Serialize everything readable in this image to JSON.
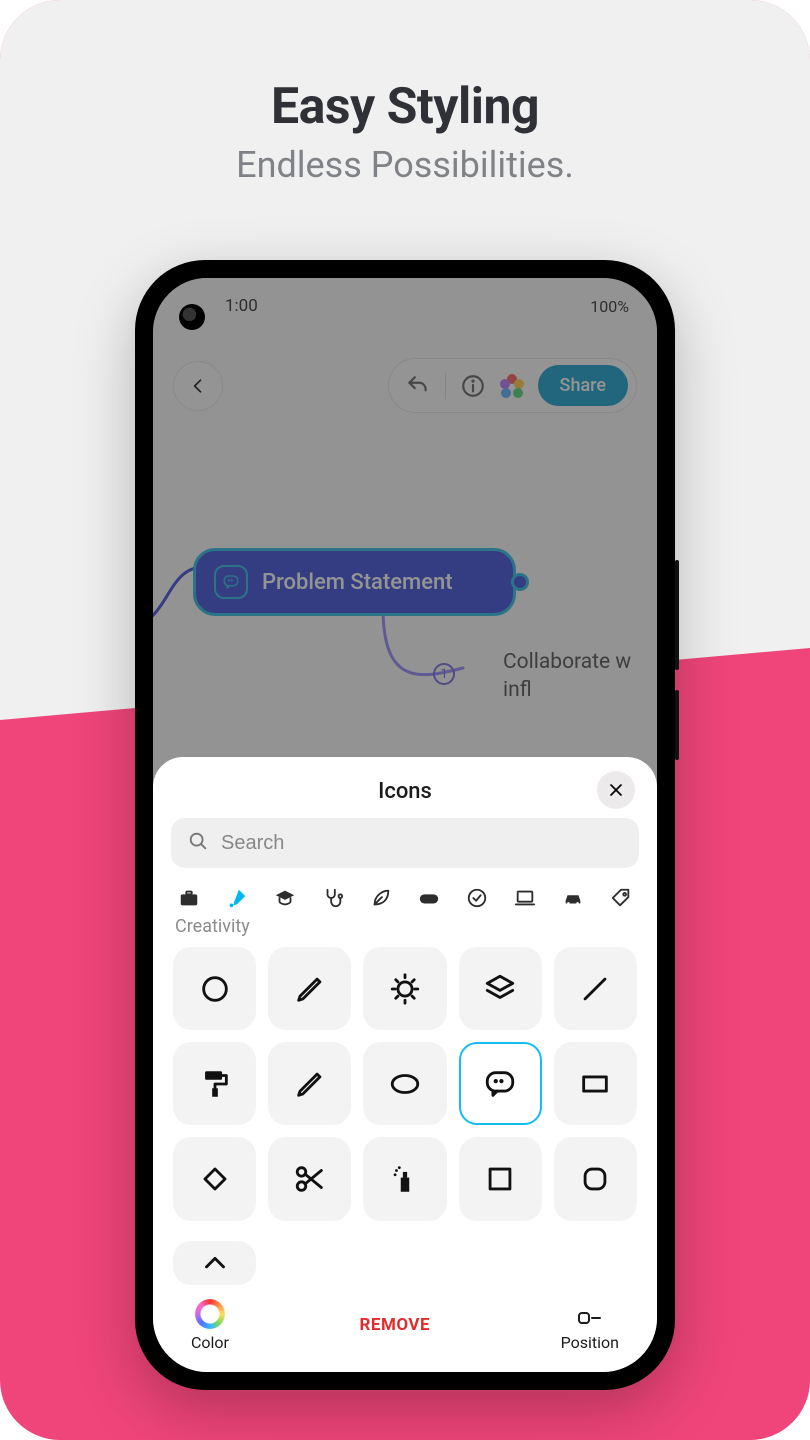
{
  "marketing": {
    "title": "Easy Styling",
    "subtitle": "Endless Possibilities."
  },
  "status": {
    "time": "1:00",
    "battery": "100%"
  },
  "topbar": {
    "share_label": "Share"
  },
  "canvas": {
    "node_label": "Problem Statement",
    "branch_text": "Collaborate w\ninfl",
    "branch_index": "1"
  },
  "sheet": {
    "title": "Icons",
    "search_placeholder": "Search",
    "category_label": "Creativity",
    "categories": [
      {
        "name": "briefcase"
      },
      {
        "name": "paint",
        "active": true
      },
      {
        "name": "graduation"
      },
      {
        "name": "stethoscope"
      },
      {
        "name": "leaf"
      },
      {
        "name": "gamepad"
      },
      {
        "name": "check-circle"
      },
      {
        "name": "laptop"
      },
      {
        "name": "car"
      },
      {
        "name": "tag"
      }
    ],
    "icons": [
      {
        "name": "circle"
      },
      {
        "name": "pencil"
      },
      {
        "name": "lightbulb"
      },
      {
        "name": "layers"
      },
      {
        "name": "slash"
      },
      {
        "name": "paint-roller"
      },
      {
        "name": "pencil-alt"
      },
      {
        "name": "ellipse"
      },
      {
        "name": "quote-bubble",
        "selected": true
      },
      {
        "name": "rectangle-wide"
      },
      {
        "name": "diamond"
      },
      {
        "name": "scissors"
      },
      {
        "name": "spray"
      },
      {
        "name": "square"
      },
      {
        "name": "rounded-square"
      }
    ],
    "bottom": {
      "color_label": "Color",
      "remove_label": "REMOVE",
      "position_label": "Position"
    }
  }
}
